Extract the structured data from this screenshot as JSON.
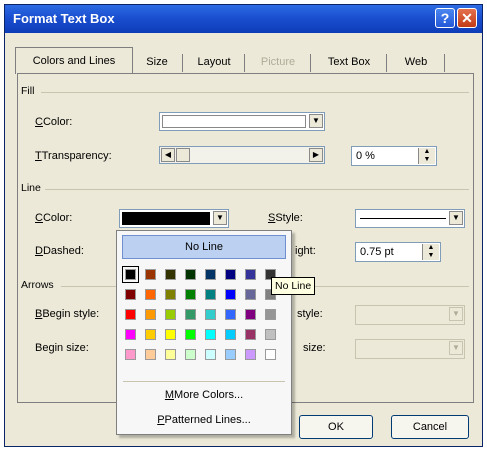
{
  "window": {
    "title": "Format Text Box",
    "help_label": "?",
    "close_label": "✕"
  },
  "tabs": [
    {
      "label": "Colors and Lines",
      "active": true
    },
    {
      "label": "Size"
    },
    {
      "label": "Layout"
    },
    {
      "label": "Picture",
      "disabled": true
    },
    {
      "label": "Text Box"
    },
    {
      "label": "Web"
    }
  ],
  "fill": {
    "group_label": "Fill",
    "color_label": "Color:",
    "transparency_label": "Transparency:",
    "transparency_value": "0 %"
  },
  "line": {
    "group_label": "Line",
    "color_label": "Color:",
    "dashed_label": "Dashed:",
    "style_label": "Style:",
    "weight_label_visible": "ight:",
    "weight_value": "0.75 pt"
  },
  "arrows": {
    "group_label": "Arrows",
    "begin_style_label": "Begin style:",
    "begin_size_label": "Begin size:",
    "end_style_label_visible": "style:",
    "end_size_label_visible": "size:"
  },
  "popup": {
    "no_line_label": "No Line",
    "more_colors_label": "More Colors...",
    "patterned_lines_label": "Patterned Lines...",
    "swatches": [
      [
        "#000000",
        "#993300",
        "#333300",
        "#003300",
        "#003366",
        "#000080",
        "#333399",
        "#333333"
      ],
      [
        "#800000",
        "#ff6600",
        "#808000",
        "#008000",
        "#008080",
        "#0000ff",
        "#666699",
        "#808080"
      ],
      [
        "#ff0000",
        "#ff9900",
        "#99cc00",
        "#339966",
        "#33cccc",
        "#3366ff",
        "#800080",
        "#969696"
      ],
      [
        "#ff00ff",
        "#ffcc00",
        "#ffff00",
        "#00ff00",
        "#00ffff",
        "#00ccff",
        "#993366",
        "#c0c0c0"
      ],
      [
        "#ff99cc",
        "#ffcc99",
        "#ffff99",
        "#ccffcc",
        "#ccffff",
        "#99ccff",
        "#cc99ff",
        "#ffffff"
      ]
    ]
  },
  "tooltip": "No Line",
  "buttons": {
    "ok_label": "OK",
    "cancel_label": "Cancel"
  }
}
